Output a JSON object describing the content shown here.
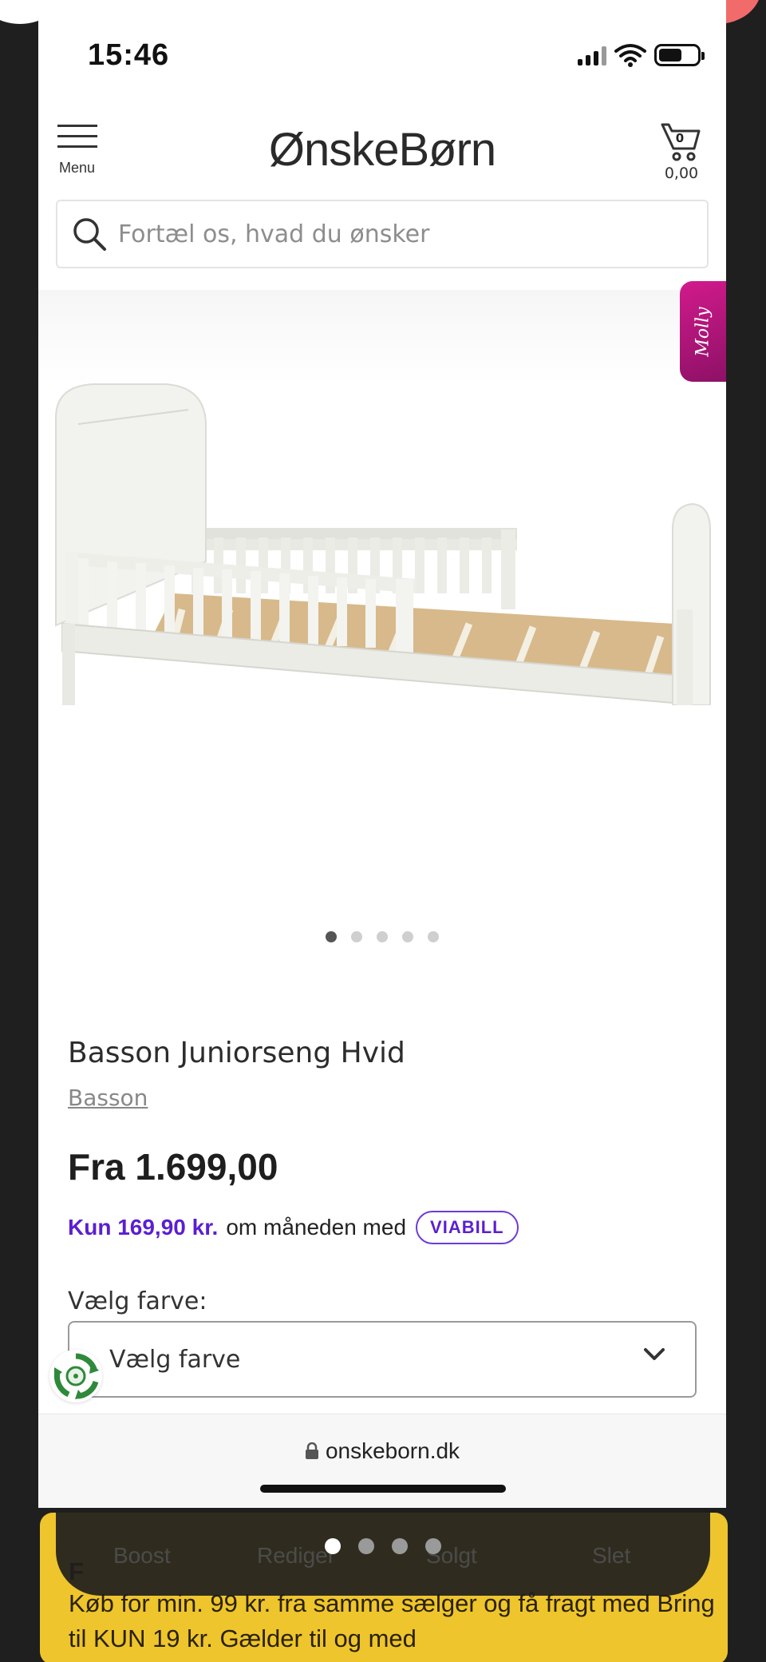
{
  "status_bar": {
    "time": "15:46"
  },
  "header": {
    "menu_label": "Menu",
    "logo": "ØnskeBørn",
    "cart_count": "0",
    "cart_total": "0,00"
  },
  "search": {
    "placeholder": "Fortæl os, hvad du ønsker"
  },
  "gallery": {
    "molly_tab": "Molly",
    "image_count": 5,
    "active_image": 1
  },
  "product": {
    "title": "Basson Juniorseng Hvid",
    "brand": "Basson",
    "price": "Fra 1.699,00",
    "financing": {
      "amount": "Kun 169,90 kr.",
      "text": "om måneden med",
      "provider": "VIABILL"
    },
    "color_label": "Vælg farve:",
    "color_select_value": "Vælg farve"
  },
  "browser": {
    "url": "onskeborn.dk"
  },
  "overlay": {
    "actions": [
      "Boost",
      "Rediger",
      "Solgt",
      "Slet"
    ],
    "page_dots": 4,
    "active_page": 1,
    "listing_heading_initial": "F",
    "listing_text": "Køb for min. 99 kr. fra samme sælger og få fragt med Bring til KUN 19 kr. Gælder til og med"
  },
  "colors": {
    "accent_purple": "#5a1fd1",
    "molly_pink": "#c2187f",
    "card_yellow": "#eec52c",
    "coral": "#f26b6b"
  }
}
